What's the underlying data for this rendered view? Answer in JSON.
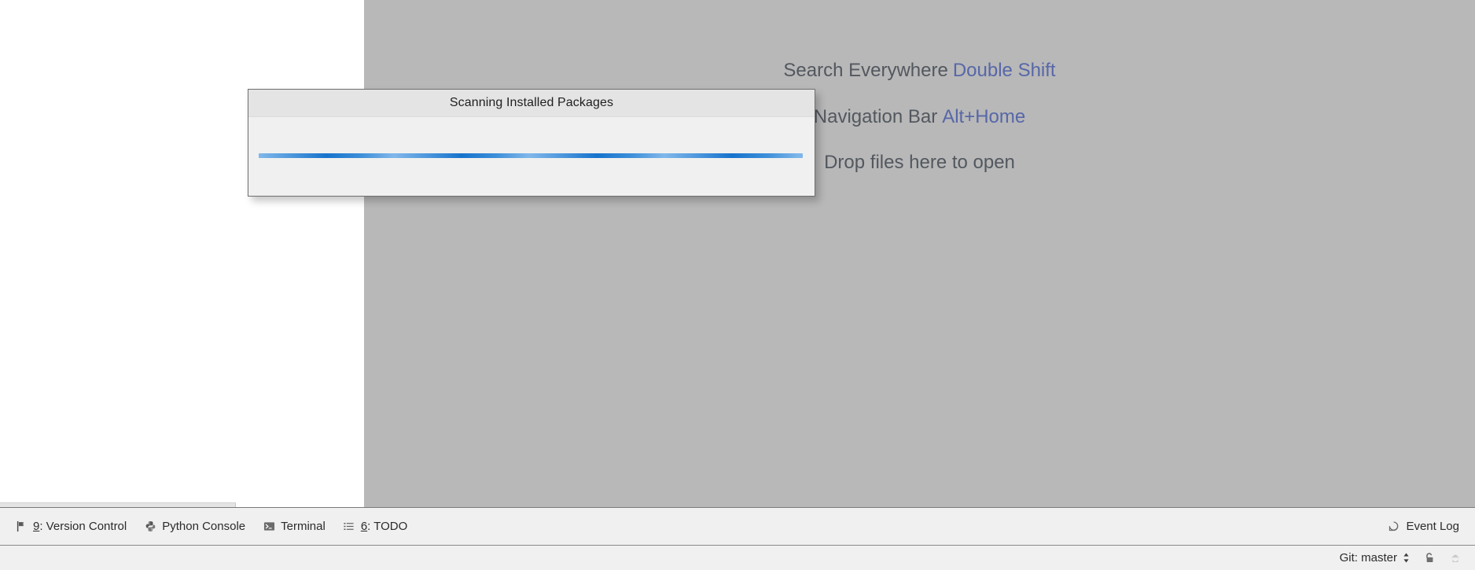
{
  "editor": {
    "hints": [
      {
        "label": "Search Everywhere",
        "shortcut": "Double Shift"
      },
      {
        "label": "Navigation Bar",
        "shortcut": "Alt+Home"
      },
      {
        "label": "Drop files here to open",
        "shortcut": ""
      }
    ]
  },
  "dialog": {
    "title": "Scanning Installed Packages",
    "progress_indeterminate": true
  },
  "toolwindow_bar": {
    "buttons": [
      {
        "mnemonic": "9",
        "label": ": Version Control",
        "icon": "vcs-branch-icon"
      },
      {
        "mnemonic": "",
        "label": "Python Console",
        "icon": "python-icon"
      },
      {
        "mnemonic": "",
        "label": "Terminal",
        "icon": "terminal-icon"
      },
      {
        "mnemonic": "6",
        "label": ": TODO",
        "icon": "todo-list-icon"
      }
    ],
    "event_log": {
      "label": "Event Log",
      "icon": "event-log-icon"
    }
  },
  "statusbar": {
    "git": {
      "label": "Git: master",
      "icon": "chevron-updown-icon"
    },
    "lock": {
      "icon": "unlocked-padlock-icon"
    },
    "inspector": {
      "icon": "inspector-hat-icon"
    }
  },
  "colors": {
    "editor_background": "#b8b8b8",
    "hint_text": "#53585f",
    "hint_shortcut": "#5767a8",
    "dialog_header": "#e4e4e4",
    "dialog_body": "#f0f0f0",
    "progress_light": "#81b7ea",
    "progress_dark": "#1673cc",
    "statusbar_background": "#f0f0f0"
  }
}
